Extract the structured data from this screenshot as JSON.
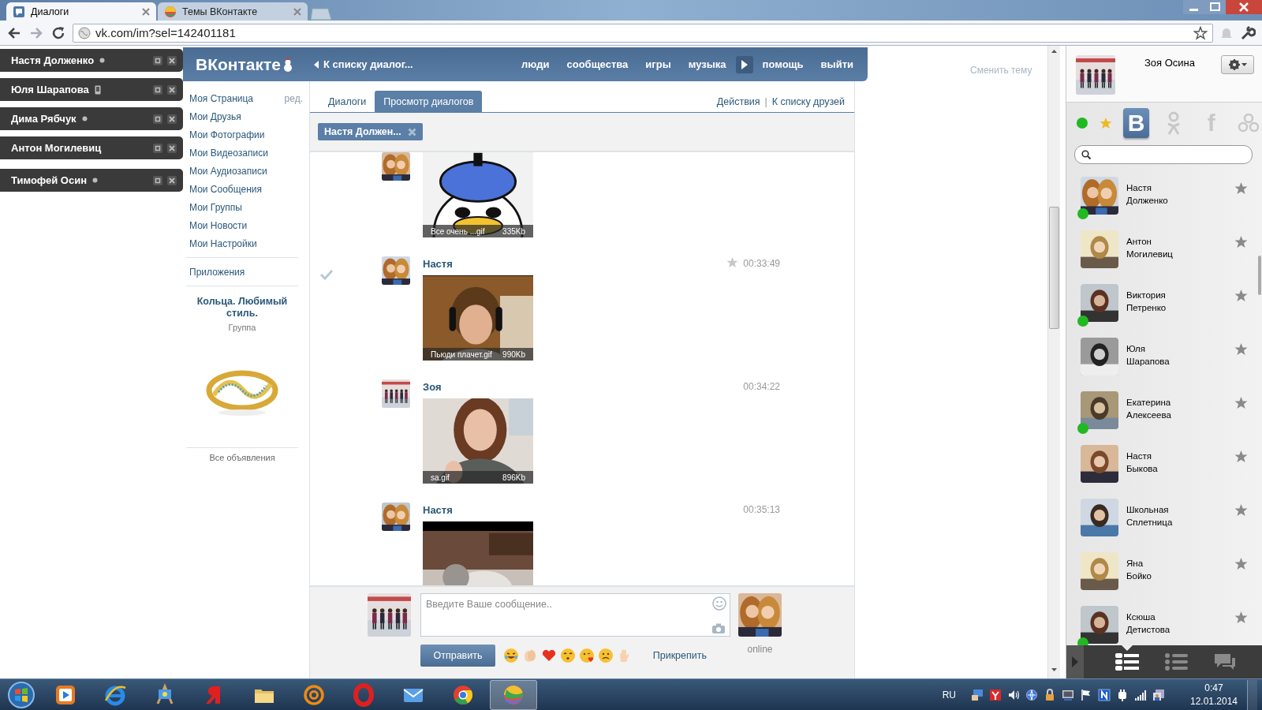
{
  "browser": {
    "tabs": [
      {
        "title": "Диалоги",
        "selected": true
      },
      {
        "title": "Темы ВКонтакте",
        "selected": false
      }
    ],
    "address": "vk.com/im?sel=142401181"
  },
  "chat_popups": [
    {
      "name": "Настя Долженко",
      "kind": "online"
    },
    {
      "name": "Юля Шарапова",
      "kind": "mobile"
    },
    {
      "name": "Дима Рябчук",
      "kind": "online"
    },
    {
      "name": "Антон Могилевиц",
      "kind": "offline"
    },
    {
      "name": "Тимофей Осин",
      "kind": "online"
    }
  ],
  "header": {
    "logo": "ВКонтакте",
    "back_link": "К списку диалог...",
    "nav": [
      {
        "kind": "link",
        "label": "люди"
      },
      {
        "kind": "link",
        "label": "сообщества"
      },
      {
        "kind": "link",
        "label": "игры"
      },
      {
        "kind": "link",
        "label": "музыка"
      },
      {
        "kind": "play"
      },
      {
        "kind": "link",
        "label": "помощь"
      },
      {
        "kind": "link",
        "label": "выйти"
      }
    ]
  },
  "theme_link": "Сменить тему",
  "left_menu": {
    "items": [
      {
        "label": "Моя Страница",
        "edit": "ред."
      },
      {
        "label": "Мои Друзья"
      },
      {
        "label": "Мои Фотографии"
      },
      {
        "label": "Мои Видеозаписи"
      },
      {
        "label": "Мои Аудиозаписи"
      },
      {
        "label": "Мои Сообщения"
      },
      {
        "label": "Мои Группы"
      },
      {
        "label": "Мои Новости"
      },
      {
        "label": "Мои Настройки"
      }
    ],
    "apps": "Приложения",
    "ad": {
      "title": "Кольца. Любимый стиль.",
      "subtitle": "Группа",
      "footer": "Все объявления"
    }
  },
  "dialogs": {
    "tabs": [
      {
        "label": "Диалоги",
        "selected": false
      },
      {
        "label": "Просмотр диалогов",
        "selected": true
      }
    ],
    "actions": [
      "Действия",
      "К списку друзей"
    ],
    "actions_separator": "|",
    "chip": "Настя Должен...",
    "messages": [
      {
        "selected": false,
        "attachment": {
          "kind": "picture",
          "caption": "Все очень ...gif",
          "size": "335Kb"
        }
      },
      {
        "selected": true,
        "author": "Настя",
        "time": "00:33:49",
        "attachment": {
          "kind": "picture",
          "caption": "Пьюди плачет.gif",
          "size": "990Kb"
        }
      },
      {
        "selected": false,
        "author": "Зоя",
        "time": "00:34:22",
        "attachment": {
          "kind": "picture",
          "caption": "sa.gif",
          "size": "896Kb"
        }
      },
      {
        "selected": false,
        "author": "Настя",
        "time": "00:35:13"
      }
    ],
    "composer": {
      "placeholder": "Введите Ваше сообщение..",
      "send": "Отправить",
      "attach": "Прикрепить",
      "status": "online"
    }
  },
  "sidebar": {
    "user": "Зоя Осина",
    "networks": [
      {
        "kind": "vk",
        "label": "В",
        "selected": true
      },
      {
        "kind": "ok",
        "selected": false
      },
      {
        "kind": "fb",
        "label": "f",
        "selected": false
      },
      {
        "kind": "group",
        "selected": false
      }
    ],
    "friends": [
      {
        "name": "Настя Долженко",
        "online": true
      },
      {
        "name": "Антон Могилевиц",
        "online": false
      },
      {
        "name": "Виктория Петренко",
        "online": true
      },
      {
        "name": "Юля Шарапова",
        "online": false
      },
      {
        "name": "Екатерина Алексеева",
        "online": true
      },
      {
        "name": "Настя Быкова",
        "online": false
      },
      {
        "name": "Школьная Сплетница",
        "online": false
      },
      {
        "name": "Яна Бойко",
        "online": false
      },
      {
        "name": "Ксюша Детистова",
        "online": true
      }
    ],
    "bottom_tabs": [
      {
        "kind": "contacts",
        "selected": true
      },
      {
        "kind": "list",
        "selected": false
      },
      {
        "kind": "chats",
        "selected": false
      }
    ]
  },
  "taskbar": {
    "apps": [
      {
        "kind": "player",
        "selected": false
      },
      {
        "kind": "ie",
        "selected": false
      },
      {
        "kind": "paint",
        "selected": false
      },
      {
        "kind": "yandex",
        "selected": false
      },
      {
        "kind": "folder",
        "selected": false
      },
      {
        "kind": "mailru",
        "selected": false
      },
      {
        "kind": "opera",
        "selected": false
      },
      {
        "kind": "mail",
        "selected": false
      },
      {
        "kind": "chrome",
        "selected": false
      },
      {
        "kind": "theme",
        "selected": true
      }
    ],
    "language": "RU",
    "time": "0:47",
    "date": "12.01.2014"
  }
}
